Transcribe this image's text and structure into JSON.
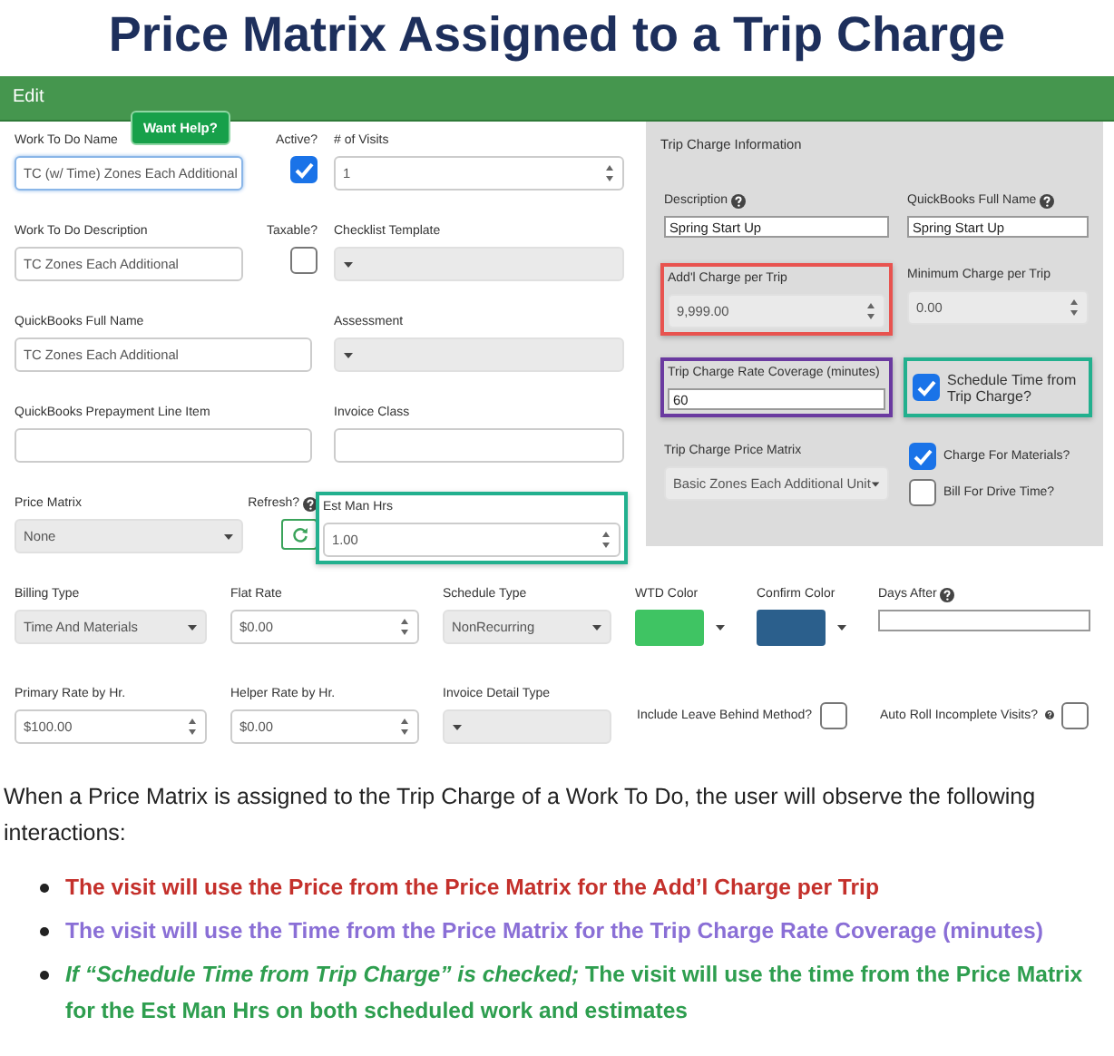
{
  "title": "Price Matrix Assigned to a Trip Charge",
  "edit_window": {
    "title": "Edit",
    "help_badge": "Want Help?",
    "left_rows": [
      [
        {
          "kind": "text",
          "label": "Work To Do Name",
          "value": "TC (w/ Time) Zones Each Additional",
          "focused": true
        },
        {
          "kind": "checkbox",
          "label": "Active?",
          "checked": true
        },
        {
          "kind": "number",
          "label": "# of Visits",
          "value": "1"
        }
      ],
      [
        {
          "kind": "text",
          "label": "Work To Do Description",
          "value": "TC Zones Each Additional"
        },
        {
          "kind": "checkbox",
          "label": "Taxable?",
          "checked": false
        },
        {
          "kind": "select",
          "label": "Checklist Template"
        }
      ],
      [
        {
          "kind": "wide_text",
          "label": "QuickBooks Full Name",
          "value": "TC Zones Each Additional"
        },
        {
          "kind": "select",
          "label": "Assessment"
        }
      ],
      [
        {
          "kind": "wide_text",
          "label": "QuickBooks Prepayment Line Item"
        },
        {
          "kind": "text",
          "label": "Invoice Class"
        }
      ],
      [
        {
          "kind": "select",
          "label": "Price Matrix",
          "value": "None"
        },
        {
          "kind": "refresh",
          "label": "Refresh?",
          "help": true
        },
        {
          "kind": "number",
          "label": "Est Man Hrs",
          "value": "1.00",
          "color": "#22b08e"
        }
      ]
    ],
    "trip_charge_panel": {
      "title": "Trip Charge Information",
      "rows": [
        [
          {
            "kind": "plain",
            "label": "Description",
            "value": "Spring Start Up",
            "help": true
          },
          {
            "kind": "plain",
            "label": "QuickBooks Full Name",
            "value": "Spring Start Up",
            "help": true
          }
        ],
        [
          {
            "kind": "number",
            "label": "Add'l Charge per Trip",
            "value": "9,999.00",
            "color": "#e8534f"
          },
          {
            "kind": "number",
            "label": "Minimum Charge per Trip",
            "value": "0.00"
          }
        ],
        [
          {
            "kind": "plain",
            "label": "Trip Charge Rate Coverage (minutes)",
            "value": "60",
            "color": "#6a3aa0"
          },
          {
            "kind": "check_label",
            "label": "Schedule Time from Trip Charge?",
            "checked": true,
            "color": "#22b08e"
          }
        ],
        [
          {
            "kind": "select",
            "label": "Trip Charge Price Matrix",
            "value": "Basic Zones Each Additional Unit"
          },
          {
            "kind": "checks",
            "items": [
              {
                "label": "Charge For Materials?",
                "checked": true
              },
              {
                "label": "Bill For Drive Time?",
                "checked": false
              }
            ]
          }
        ]
      ]
    },
    "lower_rows": [
      [
        {
          "kind": "select",
          "label": "Billing Type",
          "value": "Time And Materials"
        },
        {
          "kind": "number",
          "label": "Flat Rate",
          "value": "$0.00"
        },
        {
          "kind": "select",
          "label": "Schedule Type",
          "value": "NonRecurring"
        },
        {
          "kind": "color",
          "label": "WTD Color",
          "color": "#3fc463"
        },
        {
          "kind": "color",
          "label": "Confirm Color",
          "color": "#2b5f8c"
        },
        {
          "kind": "plain",
          "label": "Days After",
          "help": true
        }
      ],
      [
        {
          "kind": "number",
          "label": "Primary Rate by Hr.",
          "value": "$100.00"
        },
        {
          "kind": "number",
          "label": "Helper Rate by Hr.",
          "value": "$0.00"
        },
        {
          "kind": "select",
          "label": "Invoice Detail Type"
        },
        {
          "kind": "label_check",
          "label": "Include Leave Behind Method?",
          "checked": false
        },
        {
          "kind": "label_check",
          "label": "Auto Roll Incomplete Visits?",
          "checked": false,
          "help": true
        }
      ]
    ]
  },
  "intro": "When a Price Matrix is assigned to the Trip Charge of a Work To Do, the user will observe the following interactions:",
  "bullets": [
    {
      "text": "The visit will use the Price from the Price Matrix for the Add’l Charge per Trip",
      "color": "#c4302b"
    },
    {
      "text": "The visit will use the Time from the Price Matrix for the Trip Charge Rate Coverage (minutes)",
      "color": "#8a6fd6"
    },
    {
      "text": "*If “Schedule Time from Trip Charge” is checked;* The visit will use the time from the Price Matrix for the Est Man Hrs on both scheduled work and estimates",
      "color": "#2e9e4f"
    }
  ]
}
